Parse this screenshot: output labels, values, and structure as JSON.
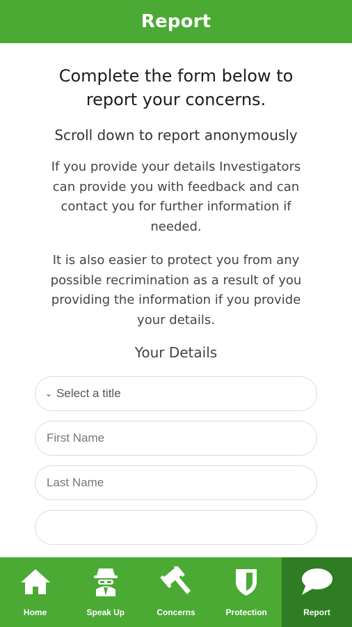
{
  "header": {
    "title": "Report"
  },
  "intro": {
    "title": "Complete the form below to report your concerns.",
    "anonymous": "Scroll down to report anonymously",
    "para1": "If you provide your details Investigators can provide you with feedback and can contact you for further information if needed.",
    "para2": "It is also easier to protect you from any possible recrimination as a result of you providing the information if you provide your details."
  },
  "details": {
    "heading": "Your Details",
    "title_select": "Select a title",
    "first_name_placeholder": "First Name",
    "last_name_placeholder": "Last Name"
  },
  "nav": {
    "items": [
      {
        "label": "Home",
        "icon": "home-icon"
      },
      {
        "label": "Speak Up",
        "icon": "spy-icon"
      },
      {
        "label": "Concerns",
        "icon": "gavel-icon"
      },
      {
        "label": "Protection",
        "icon": "shield-icon"
      },
      {
        "label": "Report",
        "icon": "speech-bubble-icon",
        "active": true
      }
    ]
  },
  "colors": {
    "brand_green": "#4aaa34",
    "active_tab": "#2e7d23"
  }
}
